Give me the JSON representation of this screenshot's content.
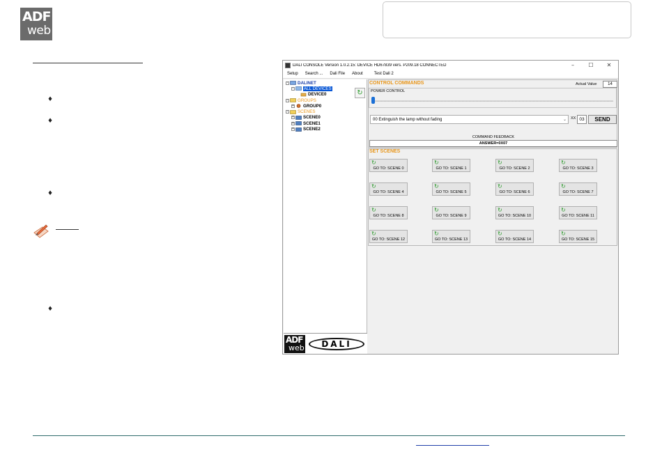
{
  "logo": {
    "line1": "ADF",
    "line2": "web"
  },
  "app": {
    "title": "DALI CONSOLE Version 1.0.2.15: DEVICE HD67839    vers. P209.18 CONNECTED",
    "window_controls": {
      "minimize": "–",
      "maximize": "☐",
      "close": "✕"
    },
    "menu": [
      "Setup",
      "Search ...",
      "Dali File",
      "About",
      "Test Dali 2"
    ],
    "tree": {
      "root": "DALINET",
      "all_devices": "ALL DEVICES",
      "device0": "DEVICE0",
      "groups": "GROUPS",
      "group0": "GROUP0",
      "scenes": "SCENES",
      "scene_items": [
        "SCENE0",
        "SCENE1",
        "SCENE2"
      ]
    },
    "refresh_icon": "↻",
    "left_logo": {
      "line1": "ADF",
      "line2": "web",
      "dali": "DALI"
    },
    "control": {
      "heading": "CONTROL COMMANDS",
      "actual_value_label": "Actual Value",
      "actual_value": "14",
      "power_control_label": "POWER CONTROL",
      "power_level_fraction": 0.0,
      "command_selected": "00 Extinguish the lamp without fading",
      "dropdown_icon": "⌄",
      "xx_label": "XX",
      "xx_value": "03",
      "send_label": "SEND",
      "feedback_label": "COMMAND FEEDBACK",
      "feedback_value": "ANSWER=0X07"
    },
    "scenes": {
      "heading": "SET SCENES",
      "scene_icon": "↻",
      "buttons": [
        "GO TO: SCENE 0",
        "GO TO: SCENE 1",
        "GO TO: SCENE 2",
        "GO TO: SCENE 3",
        "GO TO: SCENE 4",
        "GO TO: SCENE 5",
        "GO TO: SCENE 6",
        "GO TO: SCENE 7",
        "GO TO: SCENE 8",
        "GO TO: SCENE 9",
        "GO TO: SCENE 10",
        "GO TO: SCENE 11",
        "GO TO: SCENE 12",
        "GO TO: SCENE 13",
        "GO TO: SCENE 14",
        "GO TO: SCENE 15"
      ]
    }
  },
  "colors": {
    "accent_orange": "#e8961a",
    "selection_blue": "#0a58d6",
    "send_bg": "#e6e6e6"
  }
}
